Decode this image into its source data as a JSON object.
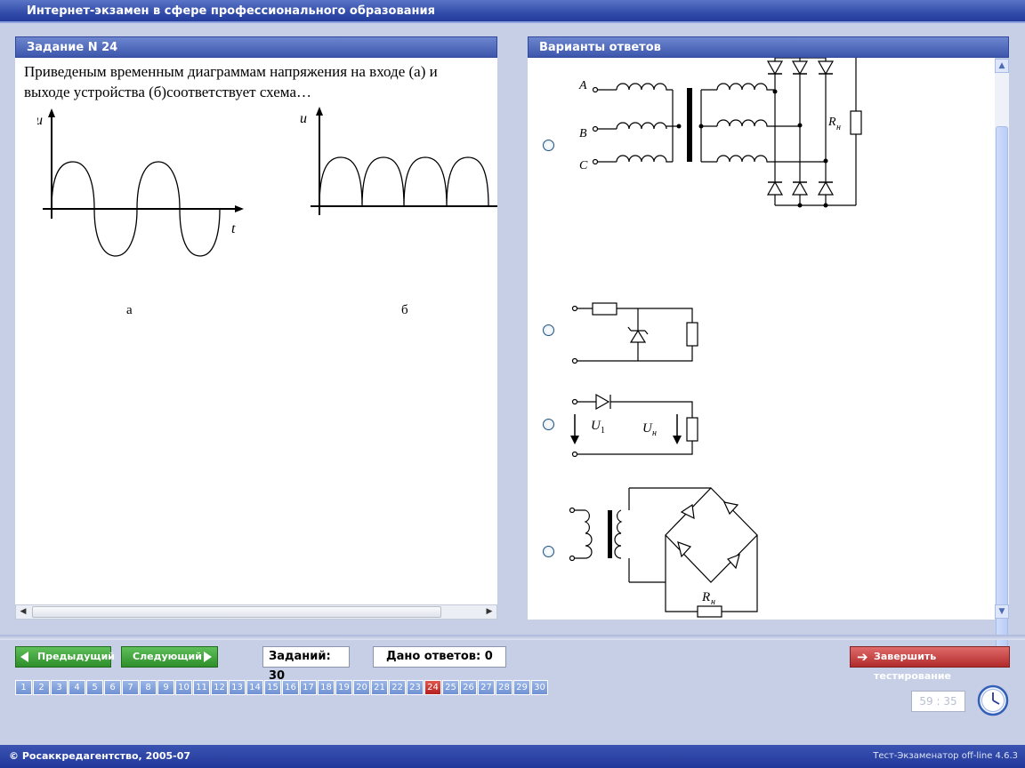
{
  "window_title": "Интернет-экзамен в сфере профессионального образования",
  "question": {
    "header": "Задание N 24",
    "text": "Приведеным  временным диаграммам напряжения на входе (а) и выходе устройства (б)соответствует схема…",
    "diagram_a": {
      "axis_y": "u",
      "axis_x": "t",
      "caption": "а"
    },
    "diagram_b": {
      "axis_y": "u",
      "caption": "б"
    }
  },
  "answers": {
    "header": "Варианты ответов",
    "option1": {
      "labels": [
        "A",
        "B",
        "C",
        "R",
        "н"
      ]
    },
    "option3": {
      "labels": [
        "U",
        "1",
        "U",
        "н"
      ]
    },
    "option4": {
      "labels": [
        "R",
        "н"
      ]
    }
  },
  "nav": {
    "prev": "Предыдущий",
    "next": "Следующий",
    "total_label": "Заданий: 30",
    "answered_label": "Дано ответов: 0",
    "finish": "Завершить тестирование"
  },
  "question_numbers": [
    "1",
    "2",
    "3",
    "4",
    "5",
    "6",
    "7",
    "8",
    "9",
    "10",
    "11",
    "12",
    "13",
    "14",
    "15",
    "16",
    "17",
    "18",
    "19",
    "20",
    "21",
    "22",
    "23",
    "24",
    "25",
    "26",
    "27",
    "28",
    "29",
    "30"
  ],
  "current_question": "24",
  "timer": "59 : 35",
  "footer": {
    "copyright": "© Росаккредагентство, 2005-07",
    "version": "Тест-Экзаменатор off-line 4.6.3"
  },
  "colors": {
    "title_bar": "#2f4aa8",
    "current_number": "#b41f1f",
    "nav_button": "#2e8e2b",
    "finish_button": "#b12b2b"
  }
}
